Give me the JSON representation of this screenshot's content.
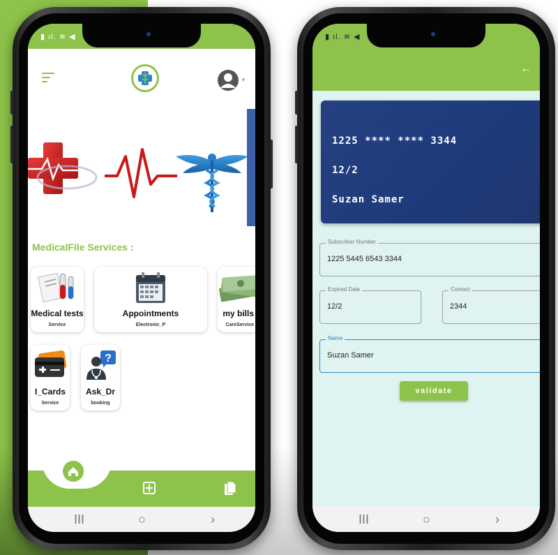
{
  "left_phone": {
    "section_title": "MedicalFile Services :",
    "services": [
      {
        "title": "Medical tests",
        "subtitle": "Service",
        "icon": "blood-test-icon"
      },
      {
        "title": "Appointments",
        "subtitle": "Electronic_P",
        "icon": "calendar-icon"
      },
      {
        "title": "my bills",
        "subtitle": "CareService",
        "icon": "money-stack-icon"
      },
      {
        "title": "I_Cards",
        "subtitle": "Service",
        "icon": "id-card-icon"
      },
      {
        "title": "Ask_Dr",
        "subtitle": "booking",
        "icon": "doctor-question-icon"
      }
    ],
    "bottom_nav": [
      "home-icon",
      "add-box-icon",
      "documents-icon"
    ],
    "system_nav": {
      "recents": "III",
      "home": "○",
      "back": "›"
    }
  },
  "right_phone": {
    "card": {
      "number": "1225 **** **** 3344",
      "expiry": "12/2",
      "holder": "Suzan Samer"
    },
    "fields": {
      "subscriber_label": "Subscriber Number",
      "subscriber_value": "1225 5445 6543 3344",
      "expired_label": "Expired Date",
      "expired_value": "12/2",
      "contact_label": "Contact",
      "contact_value": "2344",
      "name_label": "Name",
      "name_value": "Suzan Samer"
    },
    "validate_label": "validate",
    "system_nav": {
      "recents": "III",
      "home": "○",
      "back": "›"
    }
  },
  "colors": {
    "brand_green": "#8dc34a",
    "card_blue": "#254181",
    "form_bg": "#dff3f1",
    "focus_blue": "#2e86c1"
  }
}
